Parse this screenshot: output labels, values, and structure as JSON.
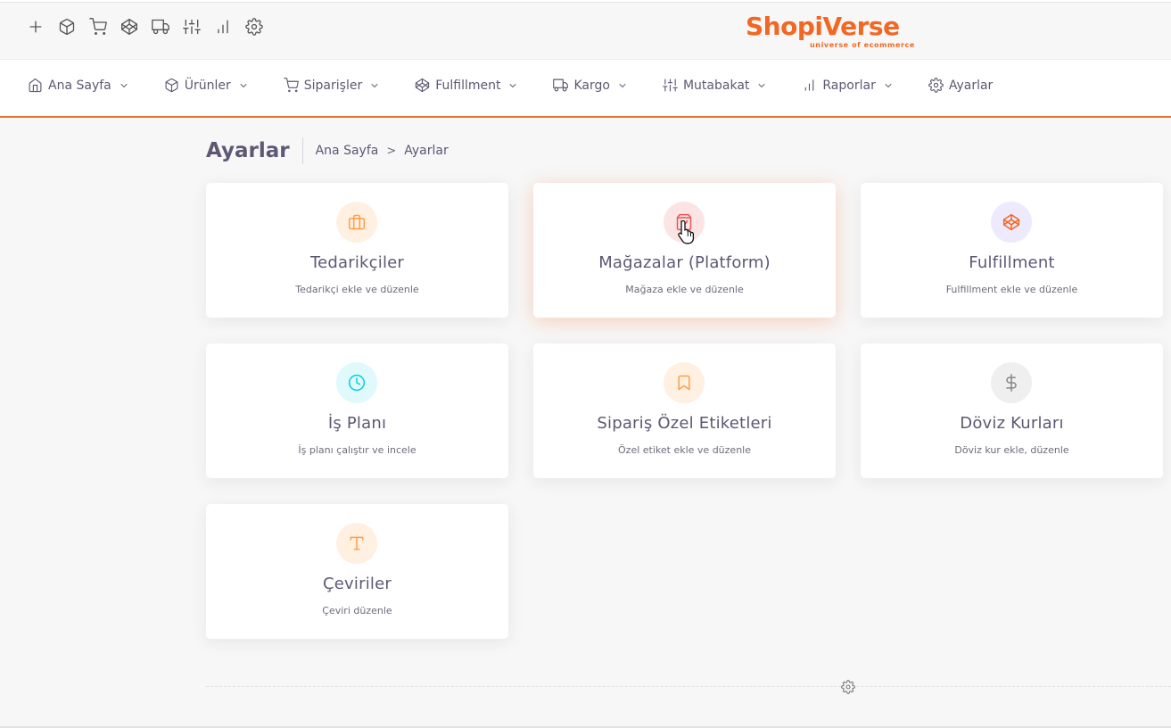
{
  "brand": {
    "name": "ShopiVerse",
    "tagline": "universe of ecommerce",
    "accent": "#f26722"
  },
  "quick_toolbar": [
    {
      "icon": "plus-icon"
    },
    {
      "icon": "box-icon"
    },
    {
      "icon": "cart-icon"
    },
    {
      "icon": "codepen-icon"
    },
    {
      "icon": "truck-icon"
    },
    {
      "icon": "sliders-icon"
    },
    {
      "icon": "bar-chart-icon"
    },
    {
      "icon": "settings-icon"
    }
  ],
  "nav": {
    "items": [
      {
        "label": "Ana Sayfa",
        "icon": "home-icon",
        "has_dropdown": true
      },
      {
        "label": "Ürünler",
        "icon": "box-icon",
        "has_dropdown": true
      },
      {
        "label": "Siparişler",
        "icon": "cart-icon",
        "has_dropdown": true
      },
      {
        "label": "Fulfillment",
        "icon": "codepen-icon",
        "has_dropdown": true
      },
      {
        "label": "Kargo",
        "icon": "truck-icon",
        "has_dropdown": true
      },
      {
        "label": "Mutabakat",
        "icon": "sliders-icon",
        "has_dropdown": true
      },
      {
        "label": "Raporlar",
        "icon": "bar-chart-icon",
        "has_dropdown": true
      },
      {
        "label": "Ayarlar",
        "icon": "settings-icon",
        "has_dropdown": false
      }
    ]
  },
  "page": {
    "title": "Ayarlar",
    "breadcrumb": {
      "home": "Ana Sayfa",
      "separator": ">",
      "current": "Ayarlar"
    }
  },
  "cards": [
    {
      "title": "Tedarikçiler",
      "subtitle": "Tedarikçi ekle ve düzenle",
      "icon": "briefcase-icon",
      "color": "#ff9f43",
      "bg": "#fff0e1"
    },
    {
      "title": "Mağazalar (Platform)",
      "subtitle": "Mağaza ekle ve düzenle",
      "icon": "shopping-bag-icon",
      "color": "#ea5455",
      "bg": "#fce4e4"
    },
    {
      "title": "Fulfillment",
      "subtitle": "Fulfillment ekle ve düzenle",
      "icon": "codepen-icon",
      "color": "#f26722",
      "bg": "#eeeafd"
    },
    {
      "title": "İş Planı",
      "subtitle": "İş planı çalıştır ve incele",
      "icon": "clock-icon",
      "color": "#00cfe8",
      "bg": "#e0f9fc"
    },
    {
      "title": "Sipariş Özel Etiketleri",
      "subtitle": "Özel etiket ekle ve düzenle",
      "icon": "bookmark-icon",
      "color": "#ff9f43",
      "bg": "#fff0e1"
    },
    {
      "title": "Döviz Kurları",
      "subtitle": "Döviz kur ekle, düzenle",
      "icon": "dollar-icon",
      "color": "#82868b",
      "bg": "#efefef"
    },
    {
      "title": "Çeviriler",
      "subtitle": "Çeviri düzenle",
      "icon": "type-icon",
      "color": "#ff9f43",
      "bg": "#fff0e1"
    }
  ]
}
